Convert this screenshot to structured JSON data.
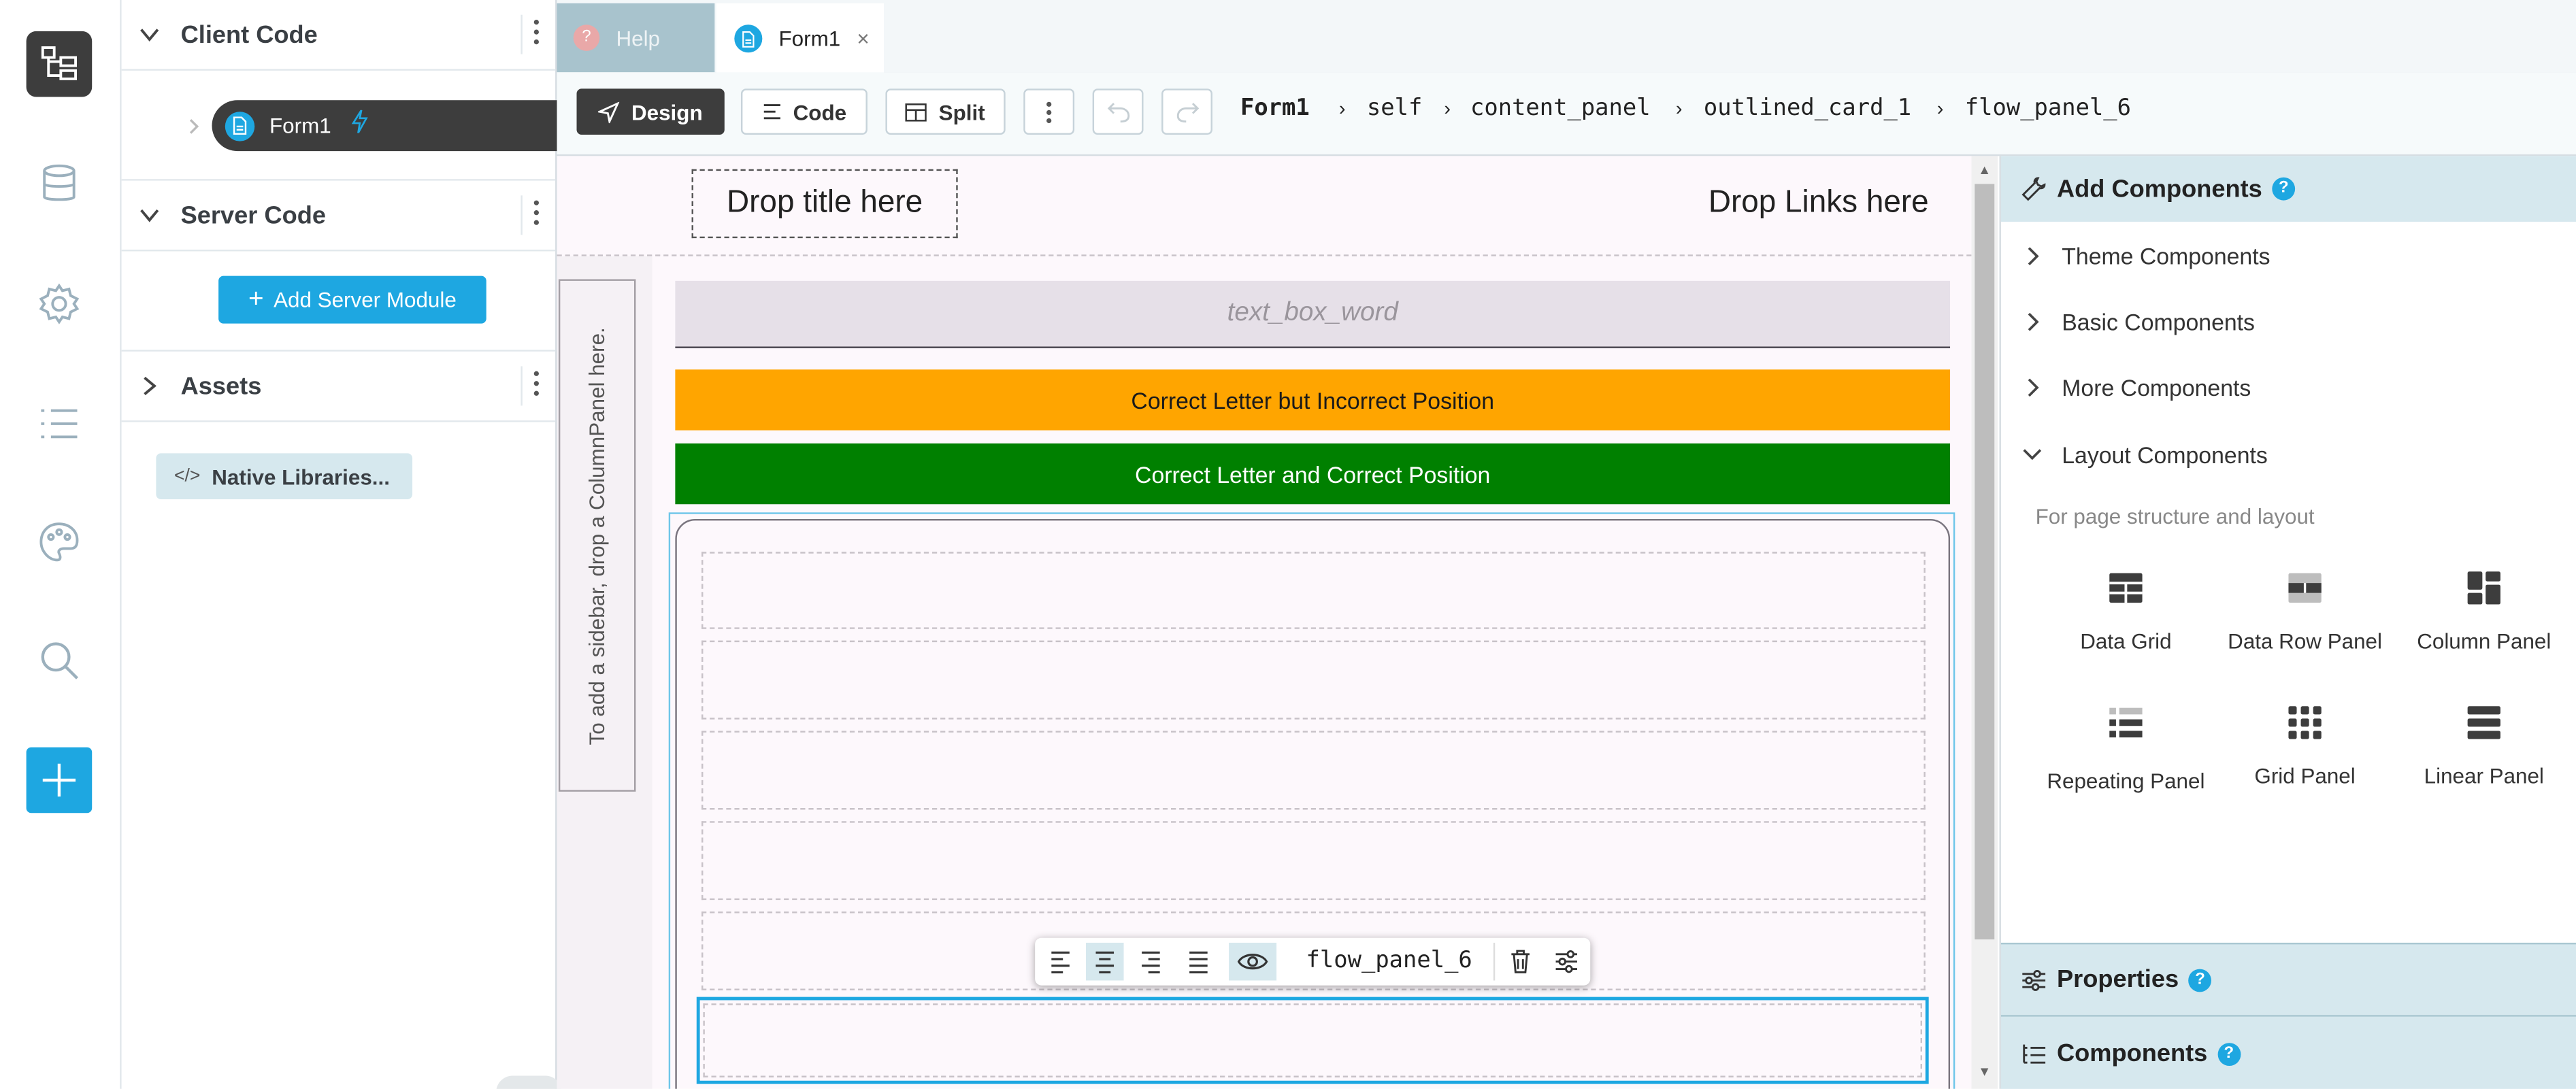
{
  "rail": {
    "icons": [
      "app-tree-icon",
      "database-icon",
      "settings-icon",
      "list-icon",
      "palette-icon",
      "search-icon",
      "add-icon"
    ]
  },
  "explorer": {
    "client_code": {
      "label": "Client Code",
      "items": [
        {
          "label": "Form1"
        }
      ]
    },
    "server_code": {
      "label": "Server Code",
      "add_button": "Add Server Module"
    },
    "assets": {
      "label": "Assets"
    },
    "native_libraries": "Native Libraries..."
  },
  "tabs": [
    {
      "label": "Help",
      "active": false
    },
    {
      "label": "Form1",
      "active": true
    }
  ],
  "toolbar": {
    "design": "Design",
    "code": "Code",
    "split": "Split",
    "breadcrumb": [
      "Form1",
      "self",
      "content_panel",
      "outlined_card_1",
      "flow_panel_6"
    ]
  },
  "canvas": {
    "title_drop": "Drop title here",
    "links_drop": "Drop Links here",
    "sidebar_hint": "To add a sidebar, drop a ColumnPanel here.",
    "textbox_placeholder": "text_box_word",
    "orange_label": "Correct Letter but Incorrect Position",
    "green_label": "Correct Letter and Correct Position",
    "selected_component": "flow_panel_6",
    "colors": {
      "orange": "#ffa500",
      "green": "#008000",
      "selection": "#1ea7e1"
    }
  },
  "right_panel": {
    "add_components": "Add Components",
    "groups": [
      "Theme Components",
      "Basic Components",
      "More Components",
      "Layout Components"
    ],
    "layout_hint": "For page structure and layout",
    "layout_items": [
      "Data Grid",
      "Data Row Panel",
      "Column Panel",
      "Repeating Panel",
      "Grid Panel",
      "Linear Panel"
    ],
    "properties": "Properties",
    "components": "Components"
  }
}
